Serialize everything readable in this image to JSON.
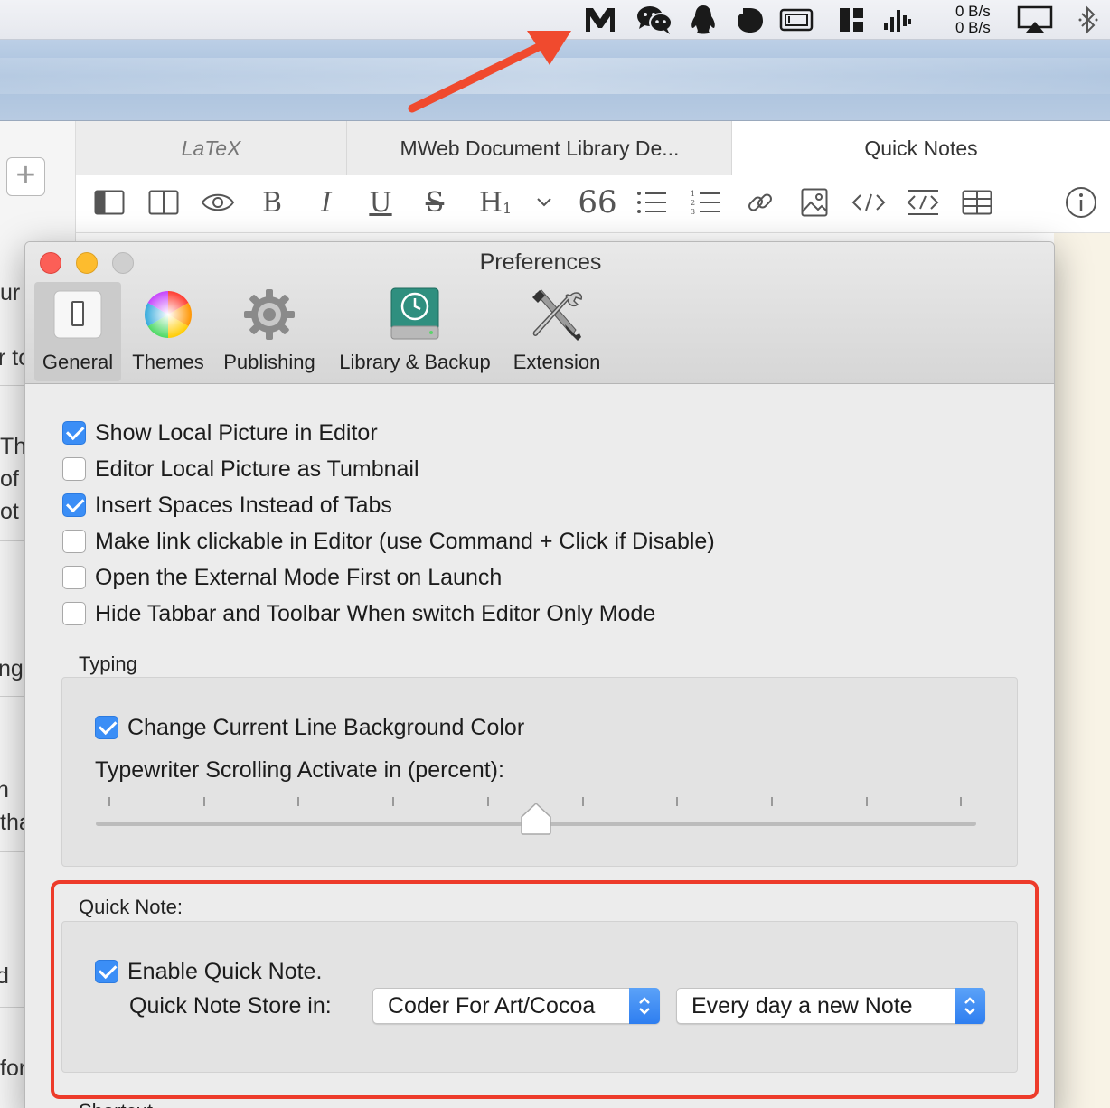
{
  "menubar": {
    "icons": [
      "mweb-icon",
      "wechat-icon",
      "qq-penguin-icon",
      "app-blob-icon",
      "screen-icon",
      "layout-icon",
      "audio-bars-icon",
      "airplay-icon",
      "bluetooth-icon"
    ],
    "net_up": "0 B/s",
    "net_down": "0 B/s"
  },
  "background_app": {
    "tabs": [
      {
        "label": "LaTeX"
      },
      {
        "label": "MWeb Document Library De..."
      },
      {
        "label": "Quick Notes"
      }
    ],
    "toolbar": {
      "bold": "B",
      "italic": "I",
      "underline": "U",
      "strike": "S",
      "heading": "H",
      "heading_sub": "1",
      "quote": "66"
    },
    "left_snippets": [
      "ur",
      "r to",
      "Th",
      "of",
      "ot",
      "ngu",
      "n",
      "tha",
      "d",
      "for"
    ]
  },
  "preferences": {
    "title": "Preferences",
    "tabs": [
      {
        "label": "General"
      },
      {
        "label": "Themes"
      },
      {
        "label": "Publishing"
      },
      {
        "label": "Library & Backup"
      },
      {
        "label": "Extension"
      }
    ],
    "options": [
      {
        "label": "Show Local Picture in Editor",
        "checked": true
      },
      {
        "label": "Editor Local Picture as Tumbnail",
        "checked": false
      },
      {
        "label": "Insert Spaces Instead of Tabs",
        "checked": true
      },
      {
        "label": "Make link clickable in Editor (use Command + Click if Disable)",
        "checked": false
      },
      {
        "label": "Open the External Mode First on Launch",
        "checked": false
      },
      {
        "label": "Hide Tabbar and Toolbar When switch Editor Only Mode",
        "checked": false
      }
    ],
    "typing": {
      "label": "Typing",
      "change_line_bg": {
        "label": "Change Current Line Background Color",
        "checked": true
      },
      "typewriter_label": "Typewriter Scrolling Activate in (percent):",
      "typewriter_value_percent": 50
    },
    "quick_note": {
      "label": "Quick Note:",
      "enable": {
        "label": "Enable Quick Note.",
        "checked": true
      },
      "store_label": "Quick Note Store in:",
      "store_value": "Coder For Art/Cocoa",
      "frequency_value": "Every day a new Note"
    },
    "next_section_partial": "Shortcut"
  },
  "colors": {
    "accent": "#3b8ef6",
    "highlight_red": "#ed3b2a",
    "arrow_red": "#f04a2e"
  }
}
